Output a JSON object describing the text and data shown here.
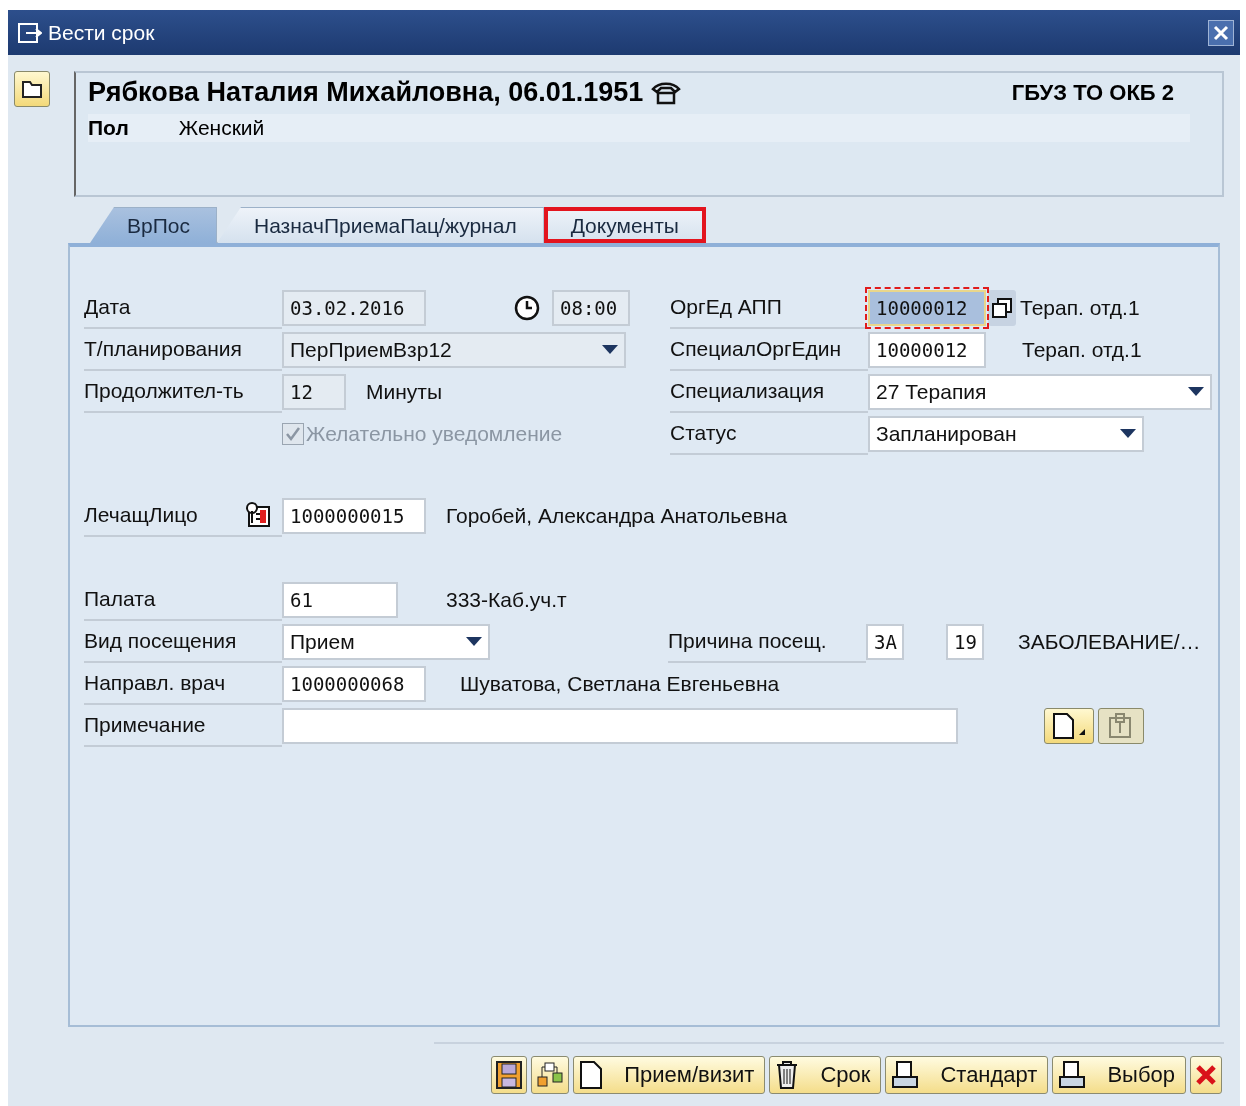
{
  "window": {
    "title": "Вести срок"
  },
  "header": {
    "patient": "Рябкова Наталия Михайловна, 06.01.1951",
    "organization": "ГБУЗ ТО ОКБ 2",
    "fields": [
      {
        "label": "Пол",
        "value": "Женский"
      }
    ]
  },
  "tabs": [
    {
      "label": "ВрПос",
      "selected": true,
      "highlighted": false
    },
    {
      "label": "НазначПриемаПац/журнал",
      "selected": false,
      "highlighted": false
    },
    {
      "label": "Документы",
      "selected": false,
      "highlighted": true
    }
  ],
  "form": {
    "date": {
      "label": "Дата",
      "value": "03.02.2016",
      "time": "08:00",
      "read_only": true
    },
    "planning_type": {
      "label": "Т/планирования",
      "value": "ПерПриемВзр12",
      "read_only": true
    },
    "duration": {
      "label": "Продолжител-ть",
      "value": "12",
      "unit": "Минуты",
      "read_only": true
    },
    "notification": {
      "label": "Желательно уведомление",
      "checked": true,
      "disabled": true
    },
    "org_unit": {
      "label": "ОргЕд АПП",
      "value": "10000012",
      "description": "Терап. отд.1",
      "focused": true
    },
    "special_org_unit": {
      "label": "СпециалОргЕдин",
      "value": "10000012",
      "description": "Терап. отд.1"
    },
    "specialization": {
      "label": "Специализация",
      "value": "27 Терапия"
    },
    "status": {
      "label": "Статус",
      "value": "Запланирован"
    },
    "attending": {
      "label": "ЛечащЛицо",
      "value": "1000000015",
      "description": "Горобей, Александра Анатольевна"
    },
    "ward": {
      "label": "Палата",
      "value": "61",
      "description": "333-Каб.уч.т"
    },
    "visit_type": {
      "label": "Вид посещения",
      "value": "Прием"
    },
    "visit_reason": {
      "label": "Причина посещ.",
      "code_1": "ЗА",
      "code_2": "19",
      "description": "ЗАБОЛЕВАНИЕ/…"
    },
    "referring_doctor": {
      "label": "Направл. врач",
      "value": "1000000068",
      "description": "Шуватова, Светлана Евгеньевна"
    },
    "note": {
      "label": "Примечание"
    }
  },
  "footer_buttons": [
    {
      "kind": "save"
    },
    {
      "kind": "hierarchy"
    },
    {
      "kind": "document",
      "label": "Прием/визит"
    },
    {
      "kind": "trash",
      "label": "Срок"
    },
    {
      "kind": "printer",
      "label": "Стандарт"
    },
    {
      "kind": "printer",
      "label": "Выбор"
    },
    {
      "kind": "cancel"
    }
  ]
}
